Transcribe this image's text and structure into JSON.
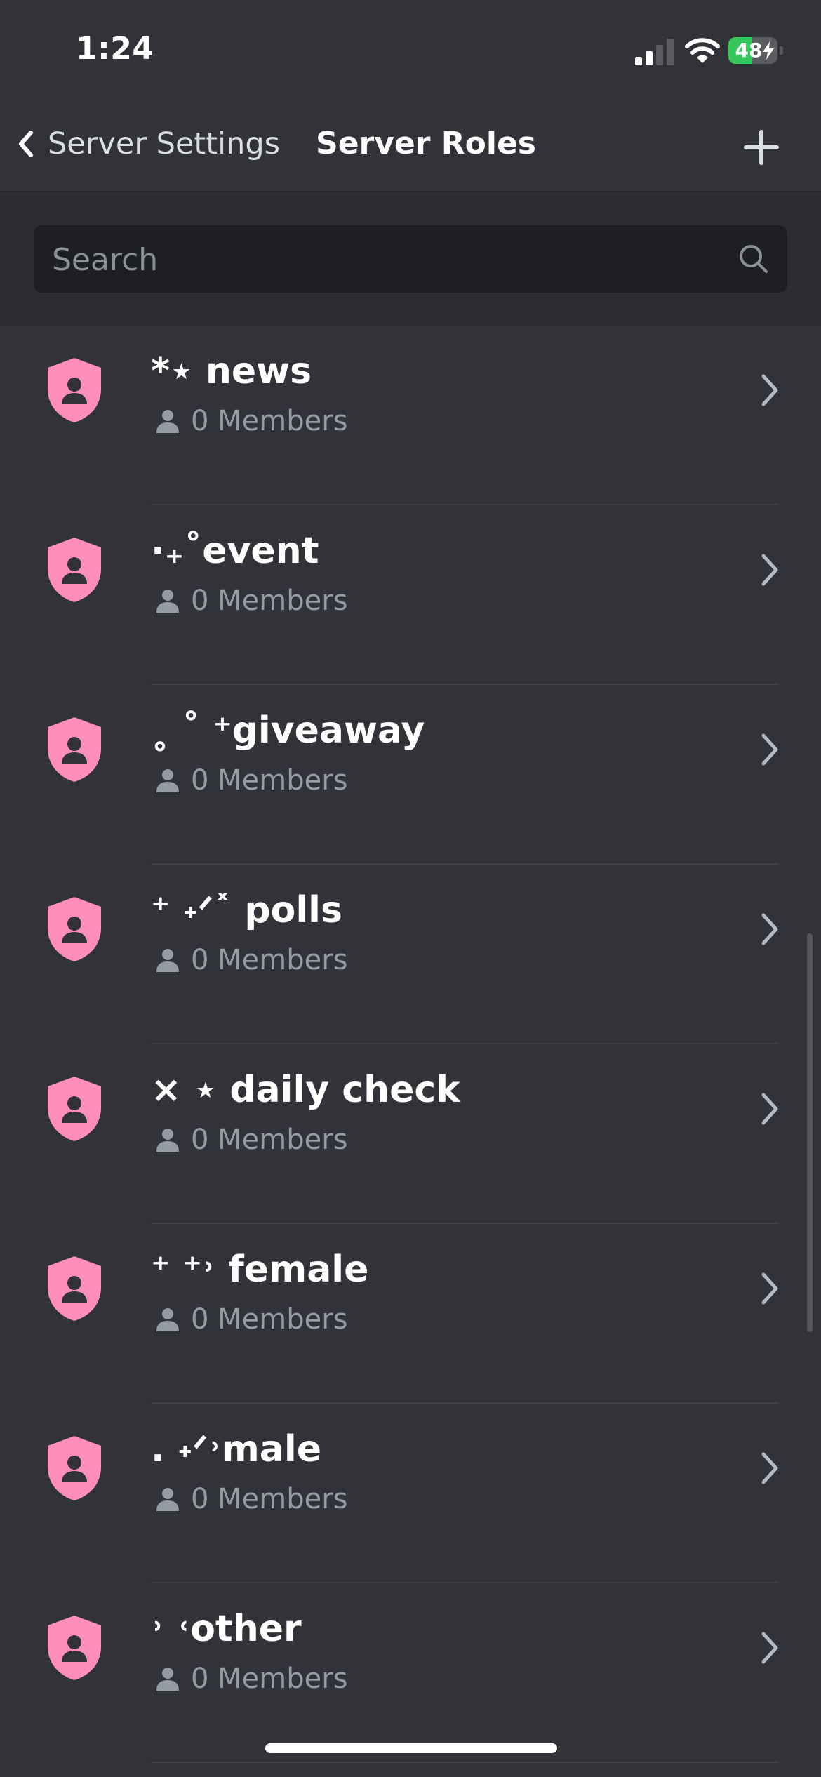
{
  "status_bar": {
    "time": "1:24",
    "battery_percent": 48,
    "battery_label": "48",
    "battery_charging": true,
    "signal_bars_active": 2,
    "signal_bars_total": 4
  },
  "nav": {
    "back_label": "Server Settings",
    "title": "Server Roles",
    "back_icon": "chevron-left-icon",
    "add_icon": "plus-icon"
  },
  "search": {
    "placeholder": "Search",
    "value": ""
  },
  "roles": [
    {
      "name": "*⋆ news",
      "members": "0 Members"
    },
    {
      "name": "·₊˚event",
      "members": "0 Members"
    },
    {
      "name": "˳ ˚ ⁺giveaway",
      "members": "0 Members"
    },
    {
      "name": "⁺ ˖ᐟ˟ polls",
      "members": "0 Members"
    },
    {
      "name": "× ⋆ daily check",
      "members": "0 Members"
    },
    {
      "name": "⁺ ⁺˒ female",
      "members": "0 Members"
    },
    {
      "name": ". ˖ᐟ˒male",
      "members": "0 Members"
    },
    {
      "name": "˒ ˓other",
      "members": "0 Members"
    }
  ],
  "colors": {
    "background": "#313338",
    "search_section": "#2b2d31",
    "search_box": "#1e1f22",
    "role_icon": "#ff8fb8",
    "muted_text": "#949ba4",
    "battery_green": "#34c759"
  },
  "icons": {
    "role": "shield-user-icon",
    "member": "person-icon",
    "row_action": "chevron-right-icon",
    "search": "search-icon"
  }
}
